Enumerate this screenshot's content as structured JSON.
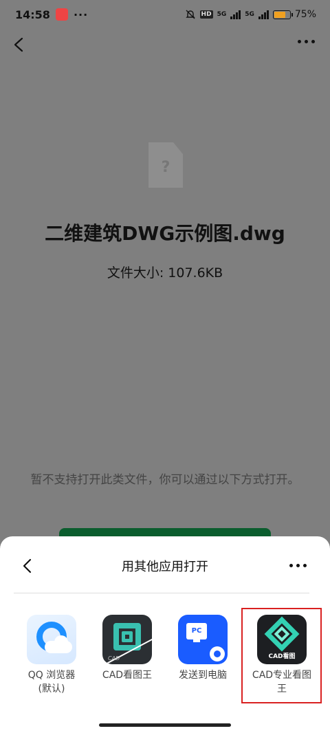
{
  "status_bar": {
    "time": "14:58",
    "more": "···",
    "hd": "HD",
    "net1": "5G",
    "net2": "5G",
    "battery_pct": "75%",
    "battery_level": 0.75
  },
  "file": {
    "icon_glyph": "?",
    "name": "二维建筑DWG示例图.dwg",
    "size": "文件大小: 107.6KB",
    "hint": "暂不支持打开此类文件，你可以通过以下方式打开。"
  },
  "sheet": {
    "title": "用其他应用打开",
    "apps": [
      {
        "label": "QQ 浏览器\n(默认)",
        "icon": "qq-browser-icon"
      },
      {
        "label": "CAD看图王",
        "icon": "cad-viewer-icon",
        "tag": "CAD"
      },
      {
        "label": "发送到电脑",
        "icon": "send-to-pc-icon",
        "tag": "PC"
      },
      {
        "label": "CAD专业看图王",
        "icon": "cad-pro-viewer-icon",
        "tag": "CAD看图"
      }
    ]
  }
}
